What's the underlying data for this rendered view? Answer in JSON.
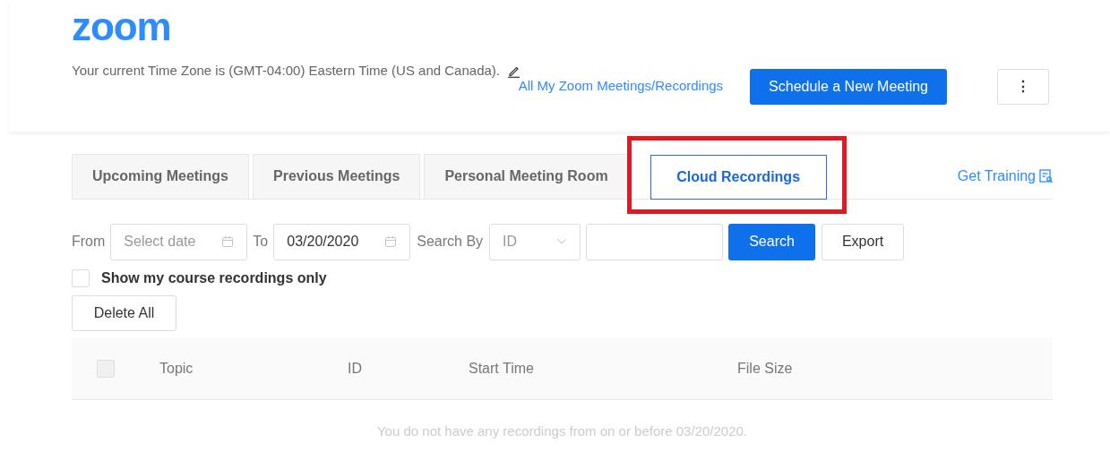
{
  "logo": "zoom",
  "header": {
    "timezone": "Your current Time Zone is (GMT-04:00) Eastern Time (US and Canada).",
    "all_meetings_link": "All My Zoom Meetings/Recordings",
    "schedule_button": "Schedule a New Meeting",
    "more_button": "⋮"
  },
  "tabs": [
    {
      "label": "Upcoming Meetings",
      "selected": false
    },
    {
      "label": "Previous Meetings",
      "selected": false
    },
    {
      "label": "Personal Meeting Room",
      "selected": false
    },
    {
      "label": "Cloud Recordings",
      "selected": true,
      "highlighted": true
    }
  ],
  "get_training": "Get Training",
  "filters": {
    "from_label": "From",
    "from_placeholder": "Select date",
    "to_label": "To",
    "to_value": "03/20/2020",
    "search_by_label": "Search By",
    "search_by_value": "ID",
    "search_button": "Search",
    "export_button": "Export"
  },
  "course_only": {
    "label": "Show my course recordings only",
    "checked": false
  },
  "delete_all": "Delete All",
  "table": {
    "select_all_checked": false,
    "columns": [
      "Topic",
      "ID",
      "Start Time",
      "File Size"
    ],
    "empty_message": "You do not have any recordings from on or before 03/20/2020."
  }
}
